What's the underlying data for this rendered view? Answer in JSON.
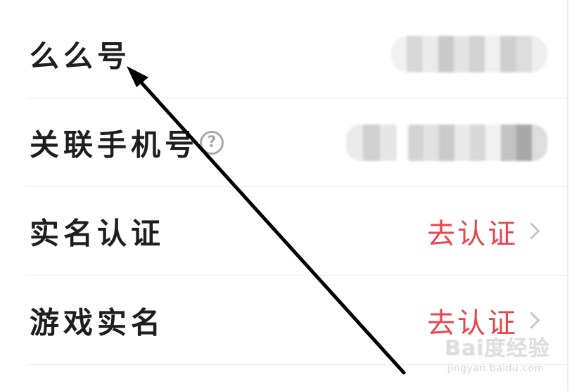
{
  "rows": [
    {
      "label": "么么号",
      "value_visibility": "blurred"
    },
    {
      "label": "关联手机号",
      "help_icon": "question-circle-icon",
      "value_visibility": "blurred"
    },
    {
      "label": "实名认证",
      "action": "去认证",
      "chevron": "chevron-right-icon"
    },
    {
      "label": "游戏实名",
      "action": "去认证",
      "chevron": "chevron-right-icon"
    }
  ],
  "help_icon_glyph": "?",
  "annotation": {
    "icon": "arrow-pointer-icon",
    "color": "#000000"
  },
  "watermark": {
    "brand": "Bai度经验",
    "url": "jingyan.baidu.com"
  },
  "colors": {
    "label": "#1e1e1e",
    "action": "#e8454e",
    "divider": "#ededed",
    "chevron": "#c6c6c6",
    "help_icon": "#a8a8a8"
  }
}
